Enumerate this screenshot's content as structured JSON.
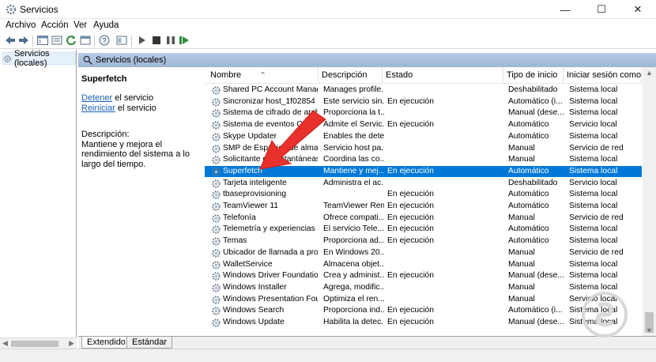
{
  "window": {
    "title": "Servicios",
    "controls": {
      "minimize": "—",
      "maximize": "☐",
      "close": "✕"
    }
  },
  "menu": [
    "Archivo",
    "Acción",
    "Ver",
    "Ayuda"
  ],
  "tree": {
    "item": "Servicios (locales)"
  },
  "content_header": "Servicios (locales)",
  "details": {
    "service_name": "Superfetch",
    "stop_link": "Detener",
    "stop_suffix": " el servicio",
    "restart_link": "Reiniciar",
    "restart_suffix": " el servicio",
    "description_label": "Descripción:",
    "description": "Mantiene y mejora el rendimiento del sistema a lo largo del tiempo."
  },
  "columns": [
    "Nombre",
    "Descripción",
    "Estado",
    "Tipo de inicio",
    "Iniciar sesión como"
  ],
  "rows": [
    {
      "name": "Shared PC Account Manager",
      "desc": "Manages profile...",
      "state": "",
      "start": "Deshabilitado",
      "logon": "Sistema local"
    },
    {
      "name": "Sincronizar host_1f02854",
      "desc": "Este servicio sin...",
      "state": "En ejecución",
      "start": "Automático (i...",
      "logon": "Sistema local"
    },
    {
      "name": "Sistema de cifrado de archi...",
      "desc": "Proporciona la t...",
      "state": "",
      "start": "Manual (dese...",
      "logon": "Sistema local"
    },
    {
      "name": "Sistema de eventos COM+",
      "desc": "Admite el Servic...",
      "state": "En ejecución",
      "start": "Automático",
      "logon": "Servicio local"
    },
    {
      "name": "Skype Updater",
      "desc": "Enables the detec...",
      "state": "",
      "start": "Automático",
      "logon": "Sistema local"
    },
    {
      "name": "SMP de Espacios de almace...",
      "desc": "Servicio host pa...",
      "state": "",
      "start": "Manual",
      "logon": "Servicio de red"
    },
    {
      "name": "Solicitante de instantáneas ...",
      "desc": "Coordina las co...",
      "state": "",
      "start": "Manual",
      "logon": "Sistema local"
    },
    {
      "name": "Superfetch",
      "desc": "Mantiene y mej...",
      "state": "En ejecución",
      "start": "Automático",
      "logon": "Sistema local",
      "selected": true
    },
    {
      "name": "Tarjeta inteligente",
      "desc": "Administra el ac...",
      "state": "",
      "start": "Deshabilitado",
      "logon": "Servicio local"
    },
    {
      "name": "tbaseprovisioning",
      "desc": "",
      "state": "En ejecución",
      "start": "Automático",
      "logon": "Sistema local"
    },
    {
      "name": "TeamViewer 11",
      "desc": "TeamViewer Rem...",
      "state": "En ejecución",
      "start": "Automático",
      "logon": "Sistema local"
    },
    {
      "name": "Telefonía",
      "desc": "Ofrece compati...",
      "state": "En ejecución",
      "start": "Manual",
      "logon": "Servicio de red"
    },
    {
      "name": "Telemetría y experiencias de...",
      "desc": "El servicio Tele...",
      "state": "En ejecución",
      "start": "Automático",
      "logon": "Sistema local"
    },
    {
      "name": "Temas",
      "desc": "Proporciona ad...",
      "state": "En ejecución",
      "start": "Automático",
      "logon": "Sistema local"
    },
    {
      "name": "Ubicador de llamada a proce...",
      "desc": "En Windows 20...",
      "state": "",
      "start": "Manual",
      "logon": "Servicio de red"
    },
    {
      "name": "WalletService",
      "desc": "Almacena objet...",
      "state": "",
      "start": "Manual",
      "logon": "Sistema local"
    },
    {
      "name": "Windows Driver Foundation...",
      "desc": "Crea y administ...",
      "state": "En ejecución",
      "start": "Manual (dese...",
      "logon": "Sistema local"
    },
    {
      "name": "Windows Installer",
      "desc": "Agrega, modific...",
      "state": "",
      "start": "Manual",
      "logon": "Sistema local"
    },
    {
      "name": "Windows Presentation Fou...",
      "desc": "Optimiza el ren...",
      "state": "",
      "start": "Manual",
      "logon": "Servicio local"
    },
    {
      "name": "Windows Search",
      "desc": "Proporciona ind...",
      "state": "En ejecución",
      "start": "Automático (i...",
      "logon": "Sistema local"
    },
    {
      "name": "Windows Update",
      "desc": "Habilita la detec...",
      "state": "En ejecución",
      "start": "Manual (dese...",
      "logon": "Sistema local"
    }
  ],
  "tabs": [
    "Extendido",
    "Estándar"
  ],
  "colors": {
    "selection": "#0078d7",
    "header_band": "#a9bfdc",
    "annotation_arrow": "#e8312c"
  }
}
